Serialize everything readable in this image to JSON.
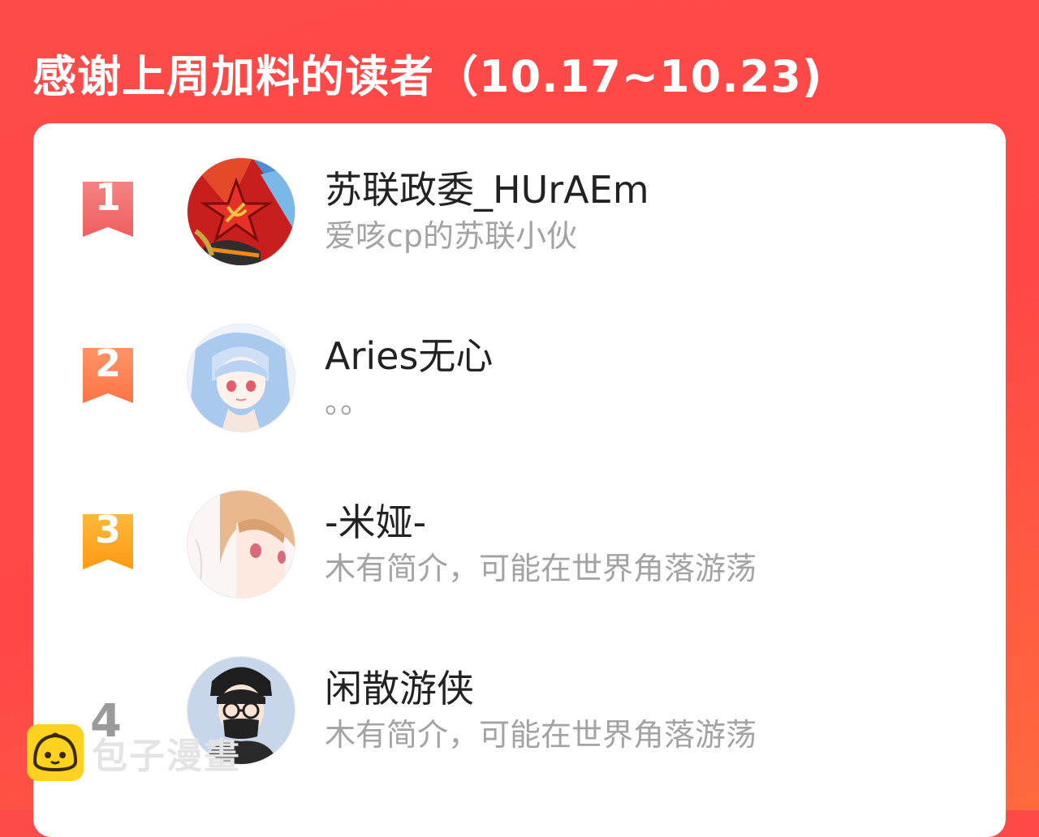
{
  "header": {
    "title": "感谢上周加料的读者（10.17~10.23)"
  },
  "ranking": [
    {
      "rank": "1",
      "name": "苏联政委_HUrAEm",
      "bio": "爱咳cp的苏联小伙",
      "badge_color": "#f56a6a",
      "avatar": "soviet-star-avatar"
    },
    {
      "rank": "2",
      "name": "Aries无心",
      "bio": "。。",
      "badge_color": "#ff7e52",
      "avatar": "anime-girl-blue-hair-avatar"
    },
    {
      "rank": "3",
      "name": "-米娅-",
      "bio": "木有简介，可能在世界角落游荡",
      "badge_color": "#ffa51f",
      "avatar": "anime-girl-brown-hair-avatar"
    },
    {
      "rank": "4",
      "name": "闲散游侠",
      "bio": "木有简介，可能在世界角落游荡",
      "avatar": "boy-glasses-mask-avatar"
    }
  ],
  "watermark": {
    "text": "包子漫畫",
    "icon": "bun-face-icon"
  }
}
